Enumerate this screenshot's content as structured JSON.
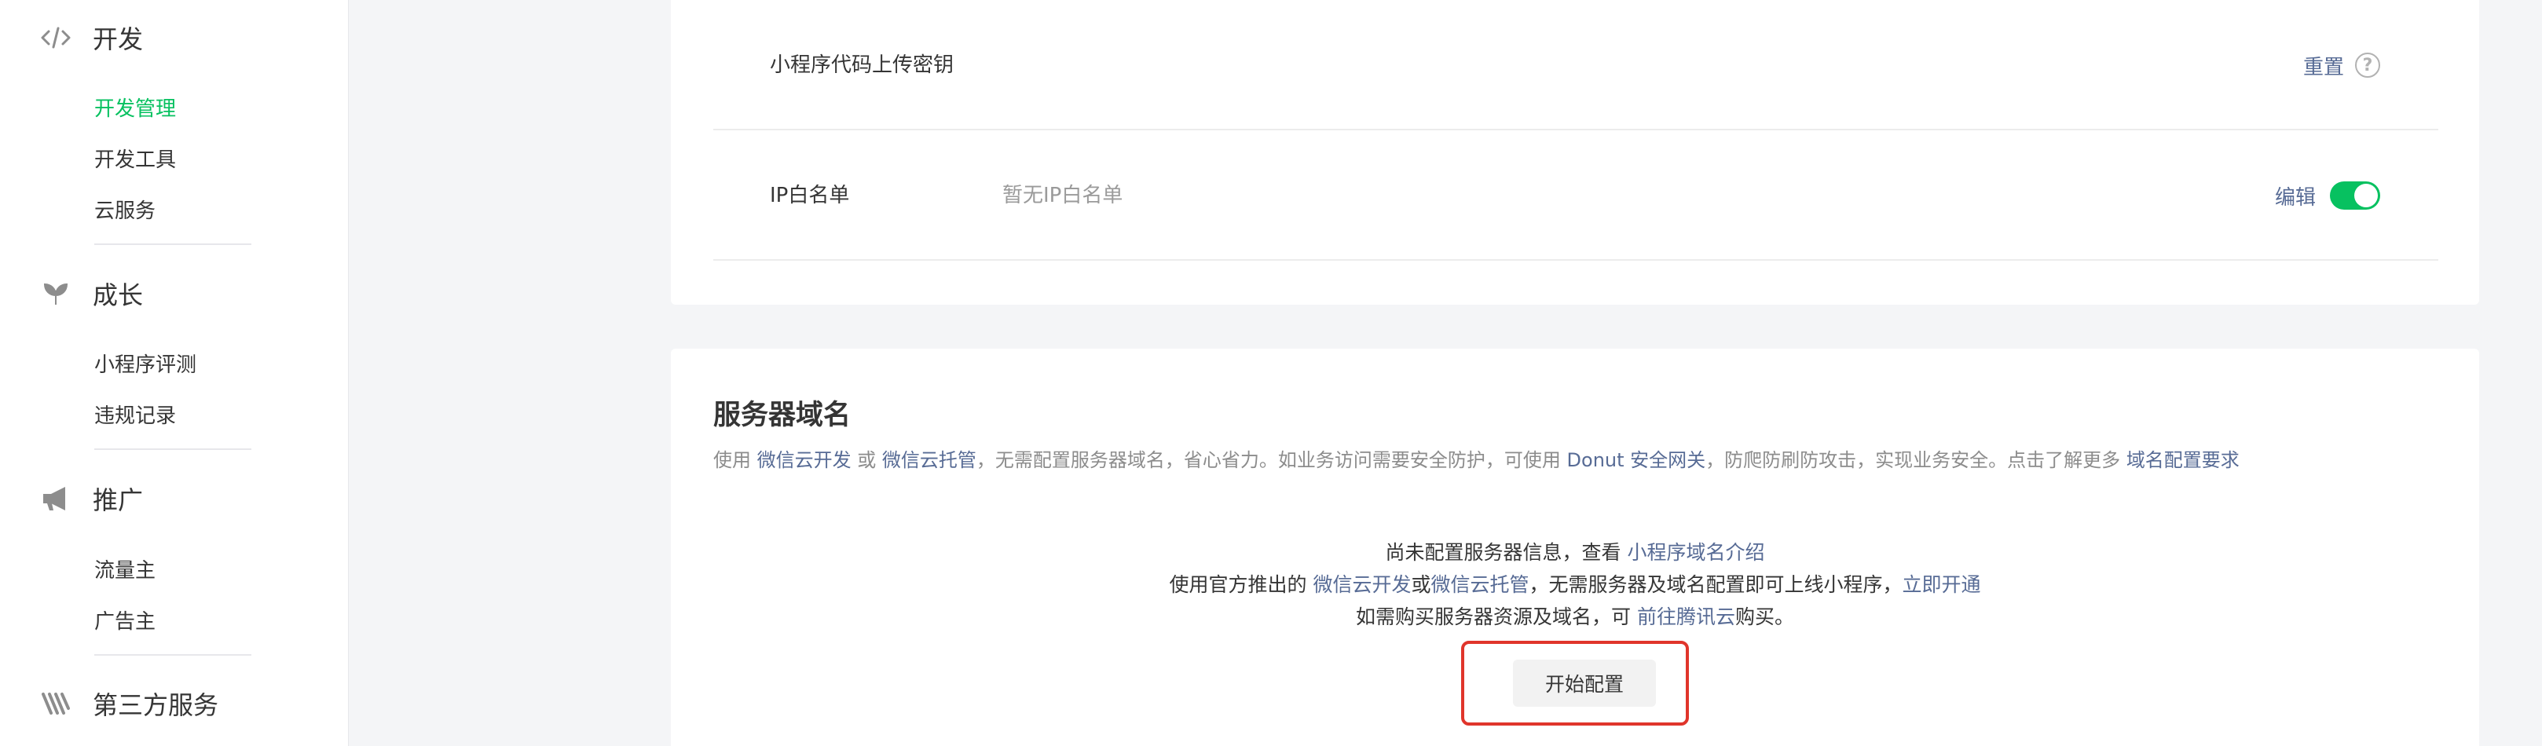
{
  "sidebar": {
    "sections": [
      {
        "title": "开发",
        "icon": "code-icon",
        "items": [
          "开发管理",
          "开发工具",
          "云服务"
        ]
      },
      {
        "title": "成长",
        "icon": "sprout-icon",
        "items": [
          "小程序评测",
          "违规记录"
        ]
      },
      {
        "title": "推广",
        "icon": "megaphone-icon",
        "items": [
          "流量主",
          "广告主"
        ]
      },
      {
        "title": "第三方服务",
        "icon": "third-party-icon",
        "items": []
      }
    ],
    "active_item": "开发管理"
  },
  "settings": {
    "upload_key": {
      "label": "小程序代码上传密钥",
      "action": "重置",
      "help": "?"
    },
    "ip_whitelist": {
      "label": "IP白名单",
      "value": "暂无IP白名单",
      "action": "编辑",
      "toggle_on": true
    }
  },
  "server_domain": {
    "title": "服务器域名",
    "desc": {
      "t1": "使用 ",
      "link1": "微信云开发",
      "t2": " 或 ",
      "link2": "微信云托管",
      "t3": "，无需配置服务器域名，省心省力。如业务访问需要安全防护，可使用 ",
      "link3": "Donut 安全网关",
      "t4": "，防爬防刷防攻击，实现业务安全。点击了解更多 ",
      "link4": "域名配置要求"
    },
    "line1": {
      "t1": "尚未配置服务器信息，查看 ",
      "link": "小程序域名介绍"
    },
    "line2": {
      "t1": "使用官方推出的 ",
      "link1": "微信云开发",
      "t2": "或",
      "link2": "微信云托管",
      "t3": "，无需服务器及域名配置即可上线小程序，",
      "link3": "立即开通"
    },
    "line3": {
      "t1": "如需购买服务器资源及域名，可 ",
      "link": "前往腾讯云",
      "t2": "购买。"
    },
    "config_button": "开始配置"
  },
  "colors": {
    "accent_green": "#07c160",
    "link_blue": "#576b95",
    "highlight_red": "#e0352b"
  }
}
